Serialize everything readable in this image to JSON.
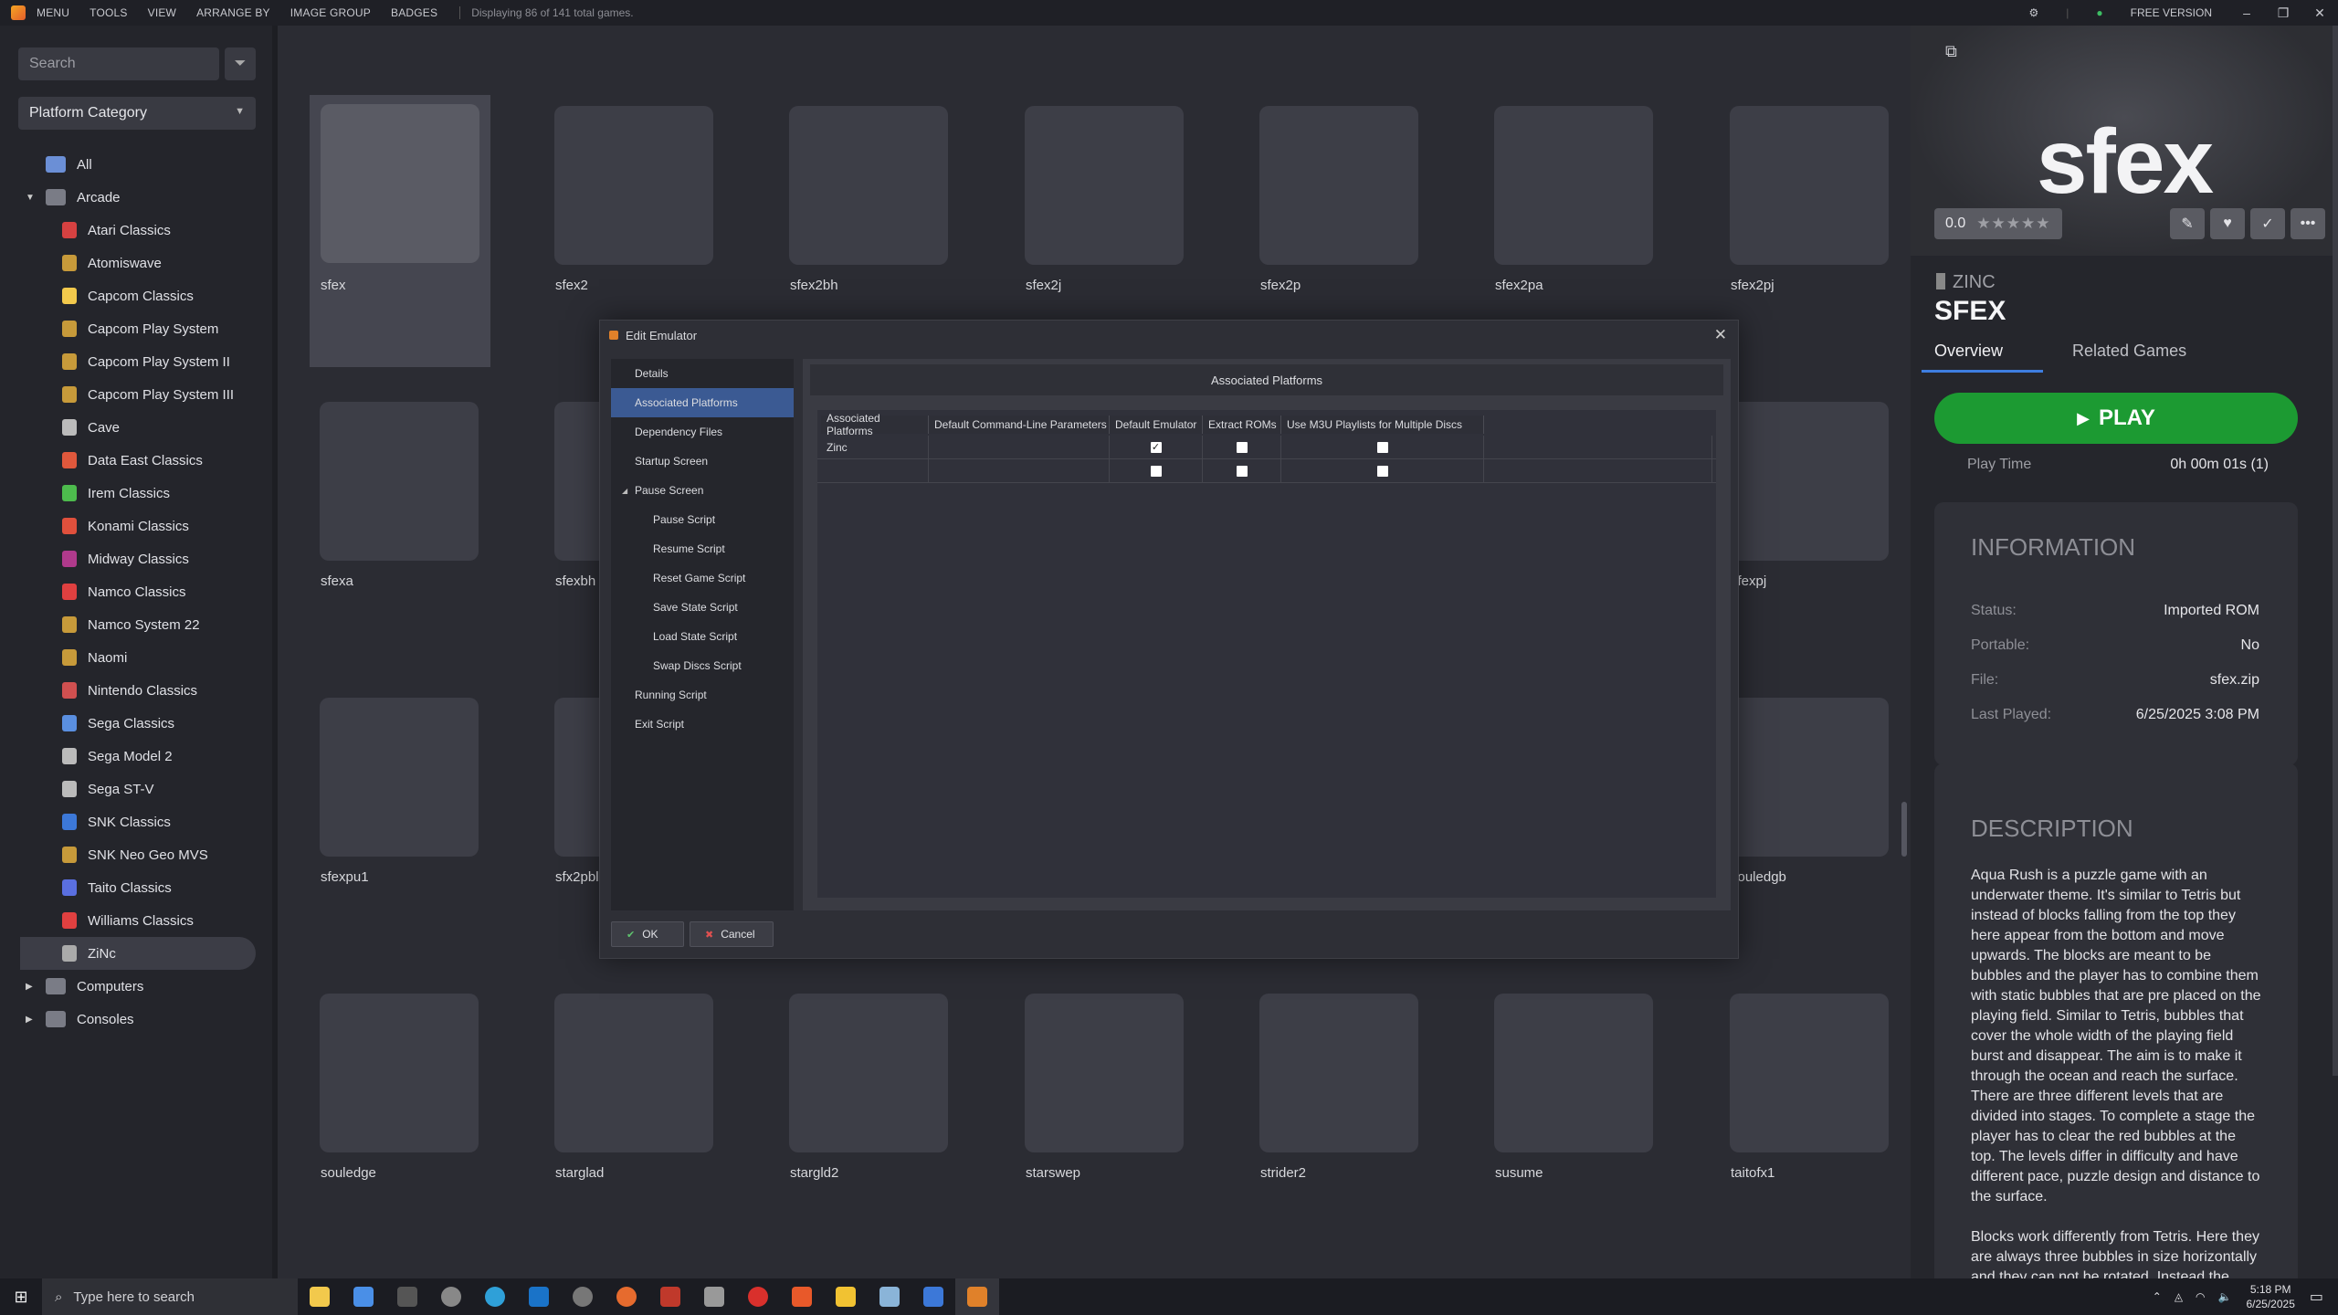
{
  "menubar": {
    "items": [
      "MENU",
      "TOOLS",
      "VIEW",
      "ARRANGE BY",
      "IMAGE GROUP",
      "BADGES"
    ],
    "status": "Displaying 86 of 141 total games.",
    "version": "FREE VERSION"
  },
  "sidebar": {
    "search_placeholder": "Search",
    "category": "Platform Category",
    "tree": [
      {
        "label": "All",
        "level": 0,
        "expander": ""
      },
      {
        "label": "Arcade",
        "level": 0,
        "expander": "▼"
      },
      {
        "label": "Atari Classics",
        "level": 1
      },
      {
        "label": "Atomiswave",
        "level": 1
      },
      {
        "label": "Capcom Classics",
        "level": 1
      },
      {
        "label": "Capcom Play System",
        "level": 1
      },
      {
        "label": "Capcom Play System II",
        "level": 1
      },
      {
        "label": "Capcom Play System III",
        "level": 1
      },
      {
        "label": "Cave",
        "level": 1
      },
      {
        "label": "Data East Classics",
        "level": 1
      },
      {
        "label": "Irem Classics",
        "level": 1
      },
      {
        "label": "Konami Classics",
        "level": 1
      },
      {
        "label": "Midway Classics",
        "level": 1
      },
      {
        "label": "Namco Classics",
        "level": 1
      },
      {
        "label": "Namco System 22",
        "level": 1
      },
      {
        "label": "Naomi",
        "level": 1
      },
      {
        "label": "Nintendo Classics",
        "level": 1
      },
      {
        "label": "Sega Classics",
        "level": 1
      },
      {
        "label": "Sega Model 2",
        "level": 1
      },
      {
        "label": "Sega ST-V",
        "level": 1
      },
      {
        "label": "SNK Classics",
        "level": 1
      },
      {
        "label": "SNK Neo Geo MVS",
        "level": 1
      },
      {
        "label": "Taito Classics",
        "level": 1
      },
      {
        "label": "Williams Classics",
        "level": 1
      },
      {
        "label": "ZiNc",
        "level": 1,
        "selected": true
      },
      {
        "label": "Computers",
        "level": 0,
        "expander": "▶"
      },
      {
        "label": "Consoles",
        "level": 0,
        "expander": "▶"
      }
    ]
  },
  "games": [
    [
      "sfex",
      "sfex2",
      "sfex2bh",
      "sfex2j",
      "sfex2p",
      "sfex2pa",
      "sfex2pj"
    ],
    [
      "sfexa",
      "sfexbh",
      "",
      "",
      "",
      "",
      "sfexpj"
    ],
    [
      "sfexpu1",
      "sfx2pbl",
      "",
      "",
      "",
      "",
      "souledgb"
    ],
    [
      "souledge",
      "starglad",
      "stargld2",
      "starswep",
      "strider2",
      "susume",
      "taitofx1"
    ]
  ],
  "detail": {
    "logo_text": "sfex",
    "rating": "0.0",
    "stars": "★★★★★",
    "platform": "ZINC",
    "title": "SFEX",
    "tabs": [
      "Overview",
      "Related Games"
    ],
    "play_label": "PLAY",
    "playtime_label": "Play Time",
    "playtime_value": "0h 00m 01s (1)",
    "info_title": "INFORMATION",
    "info": [
      {
        "k": "Status:",
        "v": "Imported ROM"
      },
      {
        "k": "Portable:",
        "v": "No"
      },
      {
        "k": "File:",
        "v": "sfex.zip"
      },
      {
        "k": "Last Played:",
        "v": "6/25/2025 3:08 PM"
      }
    ],
    "desc_title": "DESCRIPTION",
    "desc_p1": "Aqua Rush is a puzzle game with an underwater theme. It's similar to Tetris but instead of blocks falling from the top they here appear from the bottom and move upwards. The blocks are meant to be bubbles and the player has to combine them with static bubbles that are pre placed on the playing field. Similar to Tetris, bubbles that cover the whole width of the playing field burst and disappear. The aim is to make it through the ocean and reach the surface. There are three different levels that are divided into stages. To complete a stage the player has to clear the red bubbles at the top. The levels differ in difficulty and have different pace, puzzle design and distance to the surface.",
    "desc_p2": "Blocks work differently from Tetris. Here they are always three bubbles in size horizontally and they can not be rotated. Instead the player uses three buttons to"
  },
  "modal": {
    "title": "Edit Emulator",
    "nav": [
      {
        "label": "Details",
        "sub": false
      },
      {
        "label": "Associated Platforms",
        "sub": false,
        "selected": true
      },
      {
        "label": "Dependency Files",
        "sub": false
      },
      {
        "label": "Startup Screen",
        "sub": false
      },
      {
        "label": "Pause Screen",
        "sub": false,
        "toggle": "◢"
      },
      {
        "label": "Pause Script",
        "sub": true
      },
      {
        "label": "Resume Script",
        "sub": true
      },
      {
        "label": "Reset Game Script",
        "sub": true
      },
      {
        "label": "Save State Script",
        "sub": true
      },
      {
        "label": "Load State Script",
        "sub": true
      },
      {
        "label": "Swap Discs Script",
        "sub": true
      },
      {
        "label": "Running Script",
        "sub": false
      },
      {
        "label": "Exit Script",
        "sub": false
      }
    ],
    "content_title": "Associated Platforms",
    "columns": [
      "Associated Platforms",
      "Default Command-Line Parameters",
      "Default Emulator",
      "Extract ROMs",
      "Use M3U Playlists for Multiple Discs"
    ],
    "rows": [
      {
        "platform": "Zinc",
        "params": "",
        "default": true,
        "extract": false,
        "m3u": false
      },
      {
        "platform": "",
        "params": "",
        "default": false,
        "extract": false,
        "m3u": false
      }
    ],
    "ok": "OK",
    "cancel": "Cancel"
  },
  "taskbar": {
    "search_placeholder": "Type here to search",
    "time": "5:18 PM",
    "date": "6/25/2025"
  },
  "colors": {
    "accent": "#3b5a93",
    "play": "#1c9a32",
    "tab_underline": "#3e7de0"
  }
}
